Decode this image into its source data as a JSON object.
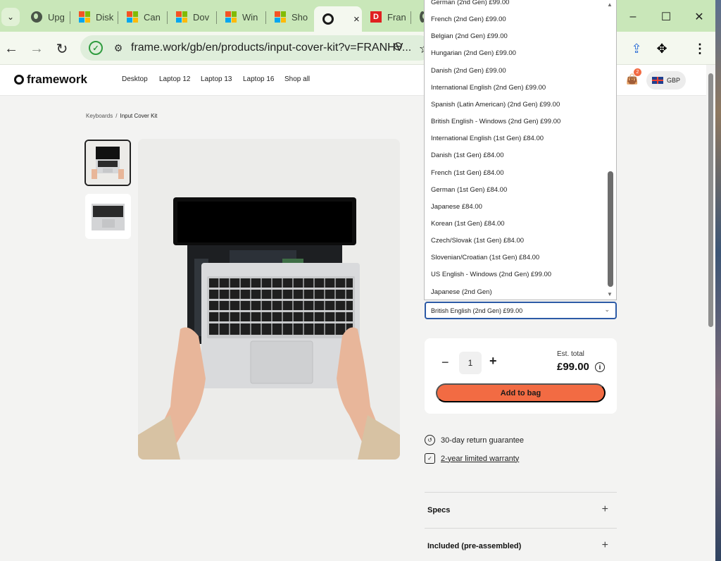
{
  "browser": {
    "tabs": [
      {
        "label": "Upg",
        "icon": "globe-icon"
      },
      {
        "label": "Disk",
        "icon": "microsoft-icon"
      },
      {
        "label": "Can",
        "icon": "microsoft-icon"
      },
      {
        "label": "Dov",
        "icon": "microsoft-icon"
      },
      {
        "label": "Win",
        "icon": "microsoft-icon"
      },
      {
        "label": "Sho",
        "icon": "microsoft-icon"
      },
      {
        "label": "",
        "icon": "framework-icon",
        "active": true
      },
      {
        "label": "Fran",
        "icon": "d-icon"
      }
    ],
    "tab_close": "×",
    "window_controls": {
      "minimize": "–",
      "maximize": "☐",
      "close": "✕"
    },
    "url": "frame.work/gb/en/products/input-cover-kit?v=FRANHV..."
  },
  "site": {
    "brand": "framework",
    "nav": [
      "Desktop",
      "Laptop 12",
      "Laptop 13",
      "Laptop 16",
      "Shop all"
    ],
    "cart_count": "2",
    "currency": "GBP"
  },
  "breadcrumb": {
    "parent": "Keyboards",
    "separator": "/",
    "current": "Input Cover Kit"
  },
  "dropdown": {
    "options": [
      "German (2nd Gen) £99.00",
      "French (2nd Gen) £99.00",
      "Belgian (2nd Gen) £99.00",
      "Hungarian (2nd Gen) £99.00",
      "Danish (2nd Gen) £99.00",
      "International English (2nd Gen) £99.00",
      "Spanish (Latin American) (2nd Gen) £99.00",
      "British English - Windows (2nd Gen) £99.00",
      "International English (1st Gen) £84.00",
      "Danish (1st Gen) £84.00",
      "French (1st Gen) £84.00",
      "German (1st Gen) £84.00",
      "Japanese £84.00",
      "Korean (1st Gen) £84.00",
      "Czech/Slovak (1st Gen) £84.00",
      "Slovenian/Croatian (1st Gen) £84.00",
      "US English - Windows (2nd Gen) £99.00",
      "Japanese (2nd Gen)"
    ],
    "selected": "British English (2nd Gen) £99.00"
  },
  "purchase": {
    "quantity": "1",
    "minus": "−",
    "plus": "+",
    "est_label": "Est. total",
    "est_price": "£99.00",
    "add_to_bag": "Add to bag"
  },
  "perks": {
    "return": "30-day return guarantee",
    "warranty": "2-year limited warranty"
  },
  "accordions": {
    "specs": "Specs",
    "included": "Included (pre-assembled)"
  },
  "colors": {
    "accent": "#f26b43",
    "focus": "#2c5aa6"
  }
}
